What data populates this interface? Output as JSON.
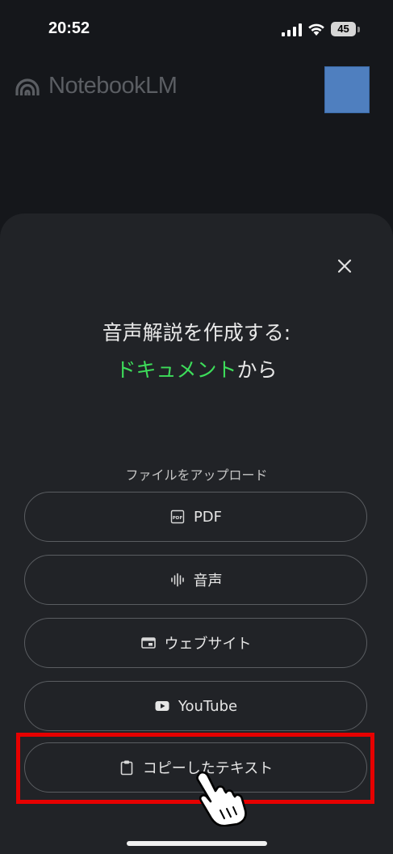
{
  "status_bar": {
    "time": "20:52",
    "battery": "45"
  },
  "header": {
    "app_name": "NotebookLM"
  },
  "sheet": {
    "title_line1": "音声解説を作成する:",
    "title_highlight": "ドキュメント",
    "title_suffix": "から",
    "section_label": "ファイルをアップロード",
    "buttons": [
      {
        "label": "PDF",
        "icon": "pdf-icon"
      },
      {
        "label": "音声",
        "icon": "audio-waveform-icon"
      },
      {
        "label": "ウェブサイト",
        "icon": "website-icon"
      },
      {
        "label": "YouTube",
        "icon": "youtube-icon"
      },
      {
        "label": "コピーしたテキスト",
        "icon": "clipboard-icon"
      }
    ]
  },
  "colors": {
    "accent_green": "#3ddc5a",
    "highlight_red": "#e60000",
    "avatar_blue": "#4f7fbf"
  }
}
